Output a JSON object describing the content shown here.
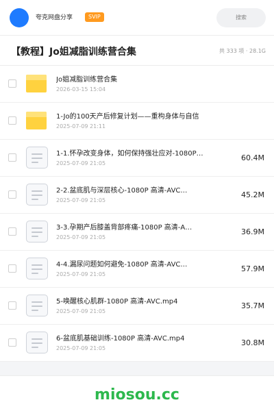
{
  "topbar": {
    "brand": "夸克网盘分享",
    "badge": "SVIP",
    "search_label": "搜索"
  },
  "share": {
    "title": "【教程】Jo姐减脂训练营合集",
    "summary": "共 333 项 · 28.1G"
  },
  "files": [
    {
      "type": "folder",
      "name": "Jo姐减脂训练营合集",
      "date": "2026-03-15 15:04",
      "size": ""
    },
    {
      "type": "folder",
      "name": "1-Jo的100天产后修复计划——重构身体与自信",
      "date": "2025-07-09 21:11",
      "size": ""
    },
    {
      "type": "video",
      "name": "1-1.怀孕改变身体，如何保持强壮应对-1080P…",
      "date": "2025-07-09 21:05",
      "size": "60.4M"
    },
    {
      "type": "video",
      "name": "2-2.盆底肌与深层核心-1080P 高清-AVC…",
      "date": "2025-07-09 21:05",
      "size": "45.2M"
    },
    {
      "type": "video",
      "name": "3-3.孕期产后膝盖背部疼痛-1080P 高清-A…",
      "date": "2025-07-09 21:05",
      "size": "36.9M"
    },
    {
      "type": "video",
      "name": "4-4.漏尿问题如何避免-1080P 高清-AVC…",
      "date": "2025-07-09 21:05",
      "size": "57.9M"
    },
    {
      "type": "video",
      "name": "5-唤醒核心肌群-1080P 高清-AVC.mp4",
      "date": "2025-07-09 21:05",
      "size": "35.7M"
    },
    {
      "type": "video",
      "name": "6-盆底肌基础训练-1080P 高清-AVC.mp4",
      "date": "2025-07-09 21:05",
      "size": "30.8M"
    }
  ],
  "footer": {
    "watermark": "miosou.cc"
  },
  "colors": {
    "accent": "#1e7bff",
    "badge": "#ff9a1f",
    "folder": "#ffd23f",
    "watermark": "#2db84d"
  },
  "icons": {
    "folder": "folder-icon",
    "video": "document-icon"
  }
}
